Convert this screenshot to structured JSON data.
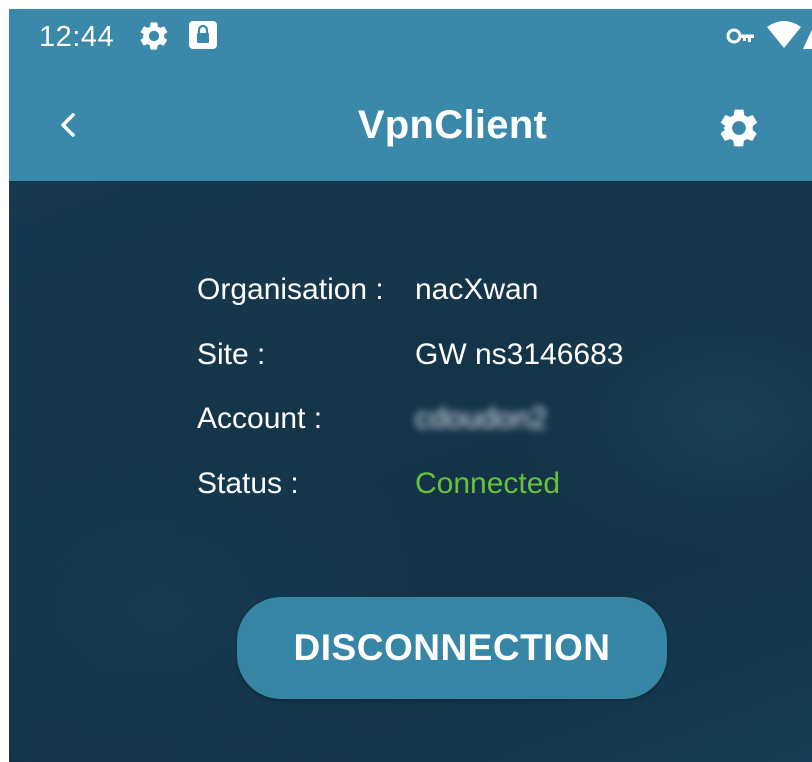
{
  "status_bar": {
    "time": "12:44",
    "icons": [
      "gear-icon",
      "lock-icon",
      "vpn-key-icon",
      "wifi-icon",
      "signal-icon"
    ]
  },
  "app_bar": {
    "title": "VpnClient",
    "back_icon": "chevron-left-icon",
    "settings_icon": "gear-icon"
  },
  "info": {
    "organisation_label": "Organisation :",
    "organisation_value": "nacXwan",
    "site_label": "Site :",
    "site_value": "GW ns3146683",
    "account_label": "Account :",
    "account_value": "cdoudon2",
    "status_label": "Status :",
    "status_value": "Connected"
  },
  "actions": {
    "disconnect_label": "DISCONNECTION"
  },
  "colors": {
    "header": "#3a88aa",
    "background": "#153649",
    "connected": "#67c23a",
    "button": "#3886a6"
  }
}
